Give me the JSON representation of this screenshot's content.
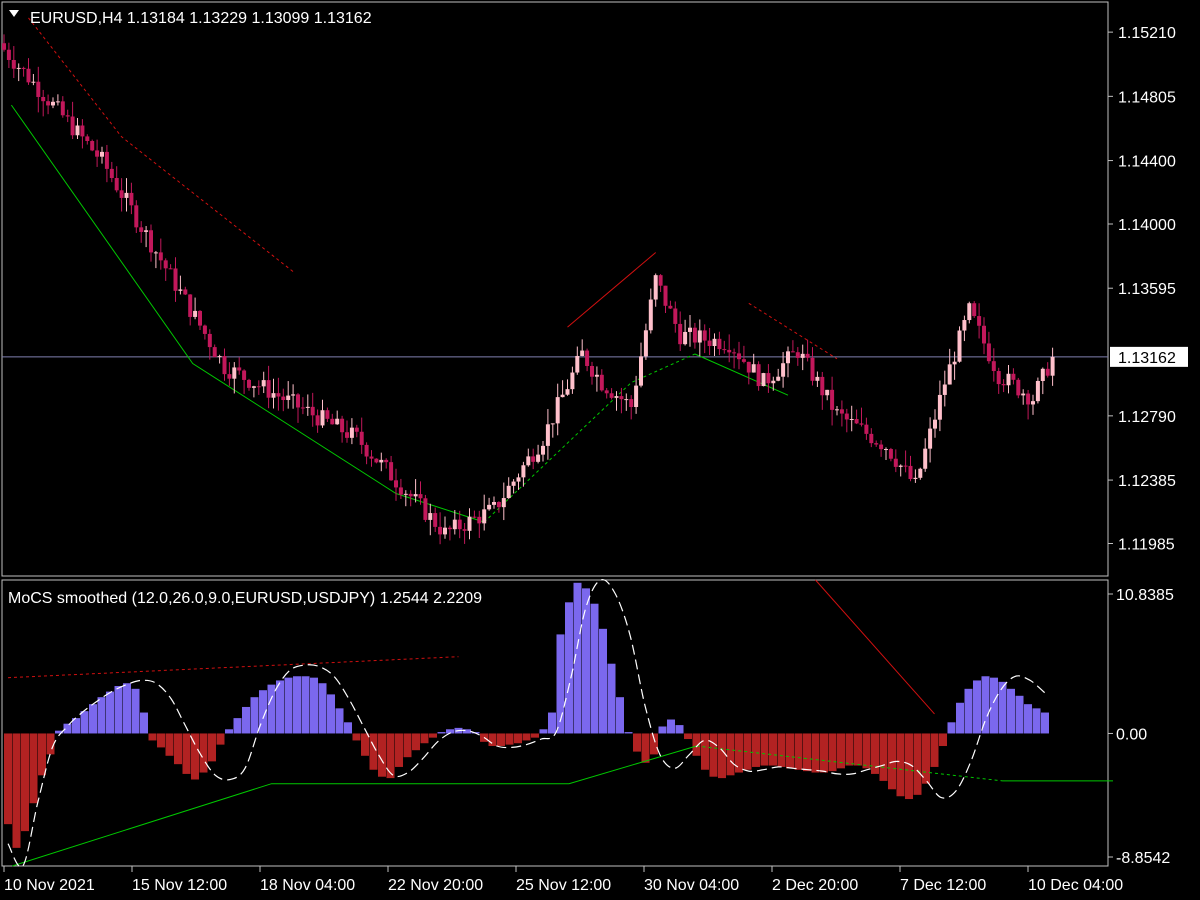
{
  "price_pane": {
    "title": "EURUSD,H4  1.13184 1.13229 1.13099 1.13162",
    "current_price_label": "1.13162",
    "axis_ticks": [
      "1.15210",
      "1.14805",
      "1.14400",
      "1.14000",
      "1.13595",
      "1.13162",
      "1.12790",
      "1.12385",
      "1.11985"
    ]
  },
  "indicator_pane": {
    "title": "MoCS smoothed (12.0,26.0,9.0,EURUSD,USDJPY) 1.2544 2.2209",
    "axis_ticks": [
      "10.8385",
      "0.00",
      "-8.8542"
    ]
  },
  "time_axis": {
    "labels": [
      "10 Nov 2021",
      "15 Nov 12:00",
      "18 Nov 04:00",
      "22 Nov 20:00",
      "25 Nov 12:00",
      "30 Nov 04:00",
      "2 Dec 20:00",
      "7 Dec 12:00",
      "10 Dec 04:00"
    ]
  },
  "colors": {
    "background": "#000000",
    "bull_candle": "#ffc0cb",
    "bear_candle": "#c2185b",
    "histogram_positive": "#7b68ee",
    "histogram_negative": "#b22222",
    "signal_line": "#ffffff",
    "support_line": "#00c800",
    "resistance_line": "#d01010",
    "frame": "#c0c0c0",
    "current_price_line": "#8080b0"
  },
  "chart_data": [
    {
      "type": "candlestick",
      "title": "EURUSD,H4",
      "ylim": [
        1.1178,
        1.154
      ],
      "current_price": 1.13162,
      "key_points": [
        {
          "bar": 0,
          "price": 1.151
        },
        {
          "bar": 20,
          "price": 1.144
        },
        {
          "bar": 45,
          "price": 1.131
        },
        {
          "bar": 72,
          "price": 1.1265
        },
        {
          "bar": 90,
          "price": 1.1205
        },
        {
          "bar": 100,
          "price": 1.122
        },
        {
          "bar": 110,
          "price": 1.1265
        },
        {
          "bar": 118,
          "price": 1.1318
        },
        {
          "bar": 122,
          "price": 1.13
        },
        {
          "bar": 128,
          "price": 1.1285
        },
        {
          "bar": 133,
          "price": 1.1365
        },
        {
          "bar": 138,
          "price": 1.133
        },
        {
          "bar": 148,
          "price": 1.1325
        },
        {
          "bar": 155,
          "price": 1.13
        },
        {
          "bar": 162,
          "price": 1.132
        },
        {
          "bar": 170,
          "price": 1.128
        },
        {
          "bar": 180,
          "price": 1.126
        },
        {
          "bar": 186,
          "price": 1.1235
        },
        {
          "bar": 192,
          "price": 1.13
        },
        {
          "bar": 197,
          "price": 1.1345
        },
        {
          "bar": 203,
          "price": 1.1305
        },
        {
          "bar": 210,
          "price": 1.129
        },
        {
          "bar": 214,
          "price": 1.1316
        }
      ],
      "trendlines": [
        {
          "kind": "support",
          "style": "solid",
          "points": [
            [
              1.5,
              1.1475
            ],
            [
              38.5,
              1.1312
            ],
            [
              80,
              1.123
            ],
            [
              98,
              1.1212
            ]
          ]
        },
        {
          "kind": "support",
          "style": "dashed",
          "points": [
            [
              98,
              1.1212
            ],
            [
              128,
              1.13
            ],
            [
              141,
              1.1318
            ]
          ]
        },
        {
          "kind": "support",
          "style": "solid",
          "points": [
            [
              141,
              1.1318
            ],
            [
              160,
              1.1292
            ]
          ]
        },
        {
          "kind": "resistance",
          "style": "dashed",
          "points": [
            [
              5,
              1.153
            ],
            [
              24,
              1.1455
            ],
            [
              59,
              1.137
            ]
          ]
        },
        {
          "kind": "resistance",
          "style": "solid",
          "points": [
            [
              115,
              1.1335
            ],
            [
              133,
              1.1382
            ]
          ]
        },
        {
          "kind": "resistance",
          "style": "dashed",
          "points": [
            [
              152,
              1.135
            ],
            [
              170,
              1.1315
            ]
          ]
        }
      ]
    },
    {
      "type": "histogram",
      "title": "MoCS smoothed",
      "ylim": [
        -9.5,
        11.0
      ],
      "values": [
        -6.5,
        -8.2,
        -7.0,
        -5.0,
        -3.0,
        -1.5,
        0.2,
        0.7,
        1.1,
        1.6,
        2.1,
        2.6,
        3.0,
        3.4,
        3.6,
        3.2,
        1.5,
        -0.5,
        -1.0,
        -1.6,
        -2.2,
        -2.9,
        -3.3,
        -2.8,
        -2.0,
        -0.8,
        0.3,
        1.1,
        1.9,
        2.6,
        3.1,
        3.5,
        3.8,
        4.0,
        4.1,
        4.1,
        4.0,
        3.6,
        2.8,
        1.8,
        0.8,
        -0.5,
        -1.6,
        -2.6,
        -3.1,
        -3.2,
        -2.4,
        -1.7,
        -1.2,
        -0.7,
        -0.3,
        0.1,
        0.3,
        0.4,
        0.3,
        0.1,
        -0.6,
        -0.9,
        -0.9,
        -0.8,
        -0.7,
        -0.5,
        -0.3,
        0.3,
        1.5,
        7.1,
        9.4,
        10.8,
        10.4,
        9.3,
        7.5,
        5.0,
        2.6,
        0.1,
        -1.3,
        -2.1,
        -1.5,
        0.5,
        1.0,
        0.6,
        -0.4,
        -1.6,
        -2.6,
        -3.1,
        -3.2,
        -3.0,
        -2.8,
        -2.6,
        -2.4,
        -2.3,
        -2.3,
        -2.4,
        -2.5,
        -2.6,
        -2.7,
        -2.8,
        -2.8,
        -2.7,
        -2.5,
        -2.3,
        -2.3,
        -2.5,
        -2.9,
        -3.4,
        -4.0,
        -4.5,
        -4.7,
        -4.4,
        -3.6,
        -2.4,
        -0.9,
        0.8,
        2.2,
        3.2,
        3.8,
        4.1,
        4.0,
        3.7,
        3.2,
        2.7,
        2.1,
        1.8,
        1.5
      ],
      "signal": [
        -7.9,
        -9.5,
        -5.0,
        -1.0,
        0.5,
        1.5,
        2.3,
        3.0,
        3.5,
        3.8,
        3.6,
        2.5,
        0.5,
        -1.5,
        -3.0,
        -3.3,
        -2.5,
        0.5,
        3.0,
        4.5,
        4.9,
        4.8,
        4.1,
        2.5,
        0.5,
        -1.5,
        -3.0,
        -2.8,
        -1.8,
        -0.6,
        0.1,
        0.2,
        -0.2,
        -0.9,
        -1.0,
        -0.8,
        -0.4,
        0.1,
        4.0,
        9.0,
        11.0,
        10.0,
        7.0,
        2.0,
        -1.5,
        -2.5,
        -1.5,
        -0.5,
        -1.0,
        -2.2,
        -2.7,
        -2.6,
        -2.4,
        -2.5,
        -2.6,
        -2.7,
        -2.9,
        -2.9,
        -2.6,
        -2.3,
        -2.0,
        -2.3,
        -3.4,
        -4.6,
        -4.1,
        -2.0,
        1.0,
        3.1,
        4.1,
        3.8,
        2.9
      ],
      "trendlines": [
        {
          "kind": "support",
          "style": "solid",
          "points": [
            [
              0.5,
              -9.5
            ],
            [
              31,
              -3.6
            ],
            [
              66,
              -3.6
            ],
            [
              81,
              -0.9
            ]
          ]
        },
        {
          "kind": "support",
          "style": "dashed",
          "points": [
            [
              81,
              -0.9
            ],
            [
              117,
              -3.4
            ]
          ]
        },
        {
          "kind": "support",
          "style": "solid",
          "points": [
            [
              117,
              -3.4
            ],
            [
              130,
              -3.4
            ]
          ]
        },
        {
          "kind": "resistance",
          "style": "dashed",
          "points": [
            [
              0,
              4.0
            ],
            [
              53,
              5.5
            ]
          ]
        },
        {
          "kind": "resistance",
          "style": "solid",
          "points": [
            [
              95,
              11.0
            ],
            [
              109,
              1.4
            ]
          ]
        }
      ]
    }
  ]
}
